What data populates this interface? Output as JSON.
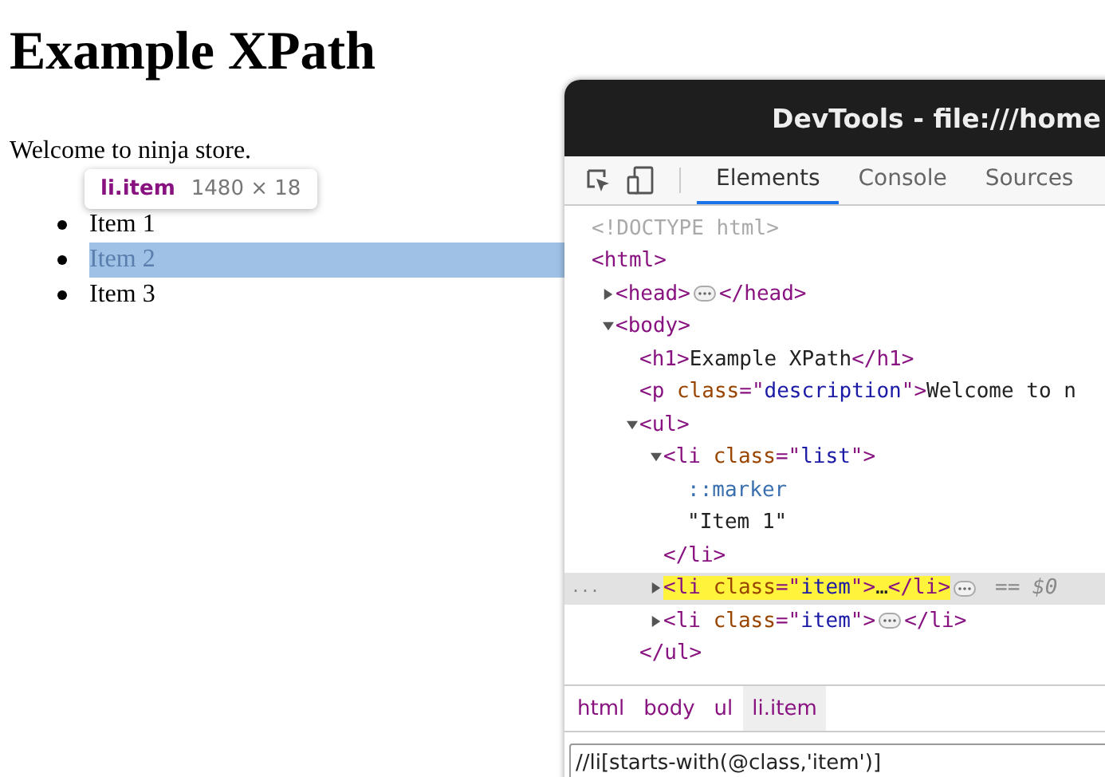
{
  "page": {
    "heading": "Example XPath",
    "description": "Welcome to ninja store.",
    "items": [
      {
        "label": "Item 1",
        "highlighted": false
      },
      {
        "label": "Item 2",
        "highlighted": true
      },
      {
        "label": "Item 3",
        "highlighted": false
      }
    ],
    "tooltip": {
      "selector": "li.item",
      "size": "1480 × 18"
    }
  },
  "devtools": {
    "title": "DevTools - file:///home",
    "tabs": [
      {
        "label": "Elements",
        "selected": true
      },
      {
        "label": "Console",
        "selected": false
      },
      {
        "label": "Sources",
        "selected": false
      }
    ],
    "tree": [
      {
        "tokens": [
          {
            "text": "<!DOCTYPE html>",
            "kind": "doctype"
          }
        ],
        "selected": false,
        "highlight": false
      },
      {
        "tokens": [
          {
            "text": "<html>",
            "kind": "tag"
          }
        ],
        "selected": false,
        "highlight": false,
        "children": [
          {
            "tokens": [
              {
                "text": "<head>",
                "kind": "tag"
              },
              {
                "kind": "more"
              },
              {
                "text": "</head>",
                "kind": "tag"
              }
            ],
            "expanded": false,
            "selected": false,
            "highlight": false
          },
          {
            "tokens": [
              {
                "text": "<body>",
                "kind": "tag"
              }
            ],
            "expanded": true,
            "selected": false,
            "highlight": false,
            "children": [
              {
                "tokens": [
                  {
                    "text": "<h1>",
                    "kind": "tag"
                  },
                  {
                    "text": "Example XPath",
                    "kind": "text"
                  },
                  {
                    "text": "</h1>",
                    "kind": "tag"
                  }
                ],
                "selected": false,
                "highlight": false
              },
              {
                "tokens": [
                  {
                    "text": "<p ",
                    "kind": "tag"
                  },
                  {
                    "text": "class",
                    "kind": "attr"
                  },
                  {
                    "text": "=\"",
                    "kind": "tag"
                  },
                  {
                    "text": "description",
                    "kind": "value"
                  },
                  {
                    "text": "\">",
                    "kind": "tag"
                  },
                  {
                    "text": "Welcome to n",
                    "kind": "text"
                  }
                ],
                "selected": false,
                "highlight": false
              },
              {
                "tokens": [
                  {
                    "text": "<ul>",
                    "kind": "tag"
                  }
                ],
                "expanded": true,
                "selected": false,
                "highlight": false,
                "close": "</ul>",
                "children": [
                  {
                    "tokens": [
                      {
                        "text": "<li ",
                        "kind": "tag"
                      },
                      {
                        "text": "class",
                        "kind": "attr"
                      },
                      {
                        "text": "=\"",
                        "kind": "tag"
                      },
                      {
                        "text": "list",
                        "kind": "value"
                      },
                      {
                        "text": "\">",
                        "kind": "tag"
                      }
                    ],
                    "expanded": true,
                    "selected": false,
                    "highlight": false,
                    "close": "</li>",
                    "children": [
                      {
                        "tokens": [
                          {
                            "text": "::marker",
                            "kind": "pseudo"
                          }
                        ],
                        "selected": false,
                        "highlight": false
                      },
                      {
                        "tokens": [
                          {
                            "text": "\"Item 1\"",
                            "kind": "text"
                          }
                        ],
                        "selected": false,
                        "highlight": false
                      }
                    ]
                  },
                  {
                    "tokens": [
                      {
                        "text": "<li ",
                        "kind": "tag"
                      },
                      {
                        "text": "class",
                        "kind": "attr"
                      },
                      {
                        "text": "=\"",
                        "kind": "tag"
                      },
                      {
                        "text": "item",
                        "kind": "value"
                      },
                      {
                        "text": "\">",
                        "kind": "tag"
                      },
                      {
                        "text": "…",
                        "kind": "text"
                      },
                      {
                        "text": "</li>",
                        "kind": "tag"
                      },
                      {
                        "kind": "more"
                      }
                    ],
                    "expanded": false,
                    "selected": true,
                    "highlight": true,
                    "gutter": "...",
                    "suffix": "== $0"
                  },
                  {
                    "tokens": [
                      {
                        "text": "<li ",
                        "kind": "tag"
                      },
                      {
                        "text": "class",
                        "kind": "attr"
                      },
                      {
                        "text": "=\"",
                        "kind": "tag"
                      },
                      {
                        "text": "item",
                        "kind": "value"
                      },
                      {
                        "text": "\">",
                        "kind": "tag"
                      },
                      {
                        "kind": "more"
                      },
                      {
                        "text": "</li>",
                        "kind": "tag"
                      }
                    ],
                    "expanded": false,
                    "selected": false,
                    "highlight": false
                  }
                ]
              }
            ]
          }
        ]
      }
    ],
    "breadcrumbs": [
      {
        "label": "html",
        "selected": false
      },
      {
        "label": "body",
        "selected": false
      },
      {
        "label": "ul",
        "selected": false
      },
      {
        "label": "li.item",
        "selected": true
      }
    ],
    "search": {
      "value": "//li[starts-with(@class,'item')]"
    }
  }
}
